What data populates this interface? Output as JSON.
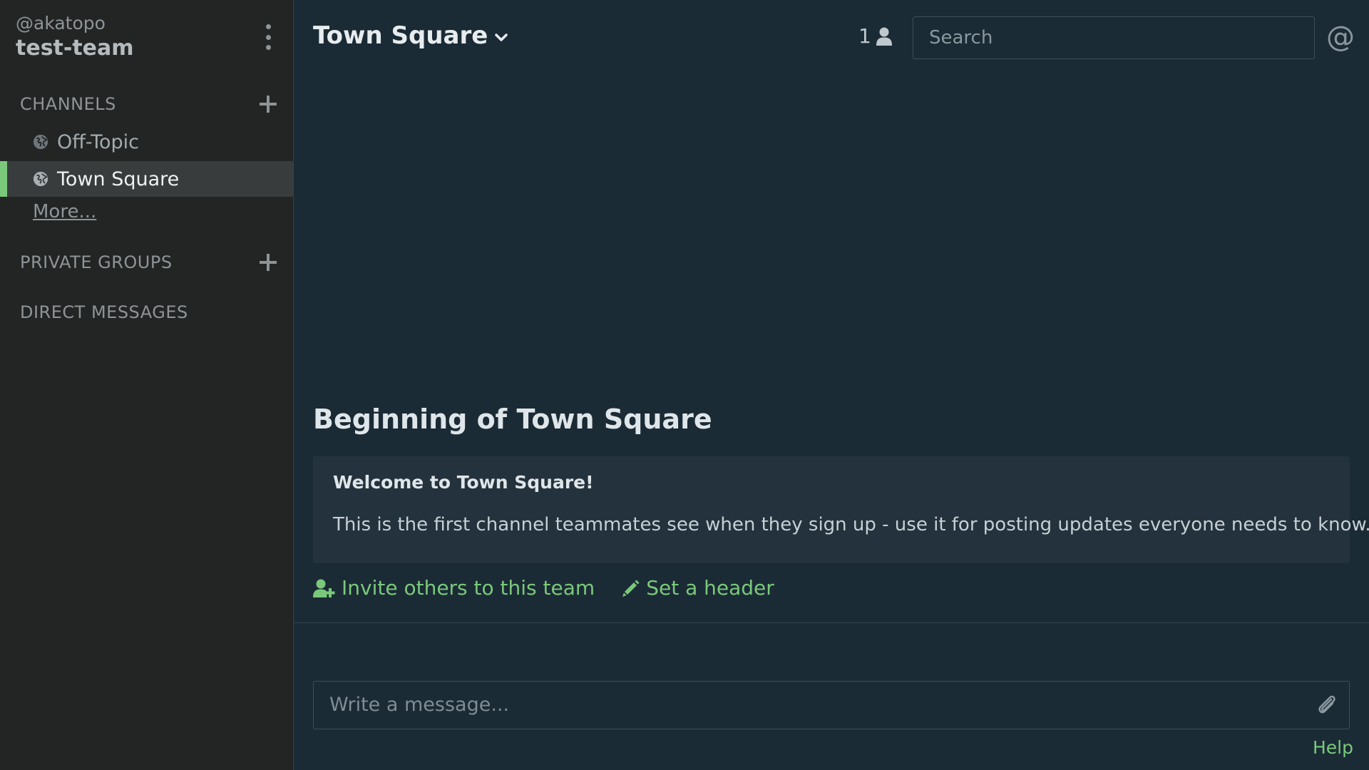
{
  "theme": {
    "accent": "#7ac97a",
    "sidebar_bg": "#232525",
    "main_bg": "#1b2b35"
  },
  "sidebar": {
    "username": "@akatopo",
    "team_name": "test-team",
    "channels_header": "CHANNELS",
    "channels": [
      {
        "label": "Off-Topic",
        "icon": "globe-icon",
        "active": false
      },
      {
        "label": "Town Square",
        "icon": "globe-icon",
        "active": true
      }
    ],
    "more_link": "More...",
    "private_groups_header": "PRIVATE GROUPS",
    "direct_messages_header": "DIRECT MESSAGES"
  },
  "header": {
    "channel_title": "Town Square",
    "member_count": "1",
    "search_placeholder": "Search",
    "mention_symbol": "@"
  },
  "intro": {
    "title": "Beginning of Town Square",
    "welcome": "Welcome to Town Square!",
    "description": "This is the first channel teammates see when they sign up - use it for posting updates everyone needs to know.",
    "invite_label": "Invite others to this team",
    "set_header_label": "Set a header"
  },
  "composer": {
    "placeholder": "Write a message...",
    "help_label": "Help"
  }
}
